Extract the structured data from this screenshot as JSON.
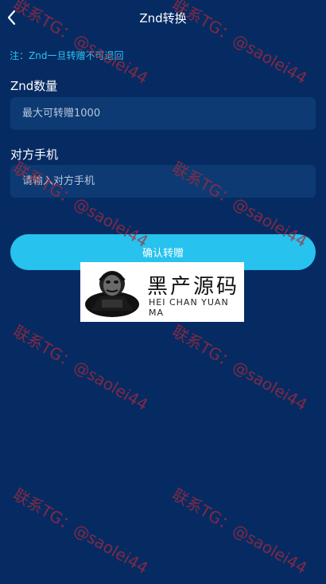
{
  "header": {
    "title": "Znd转换",
    "back_icon": "chevron-left-icon"
  },
  "notice": "注：Znd一旦转赠不可退回",
  "form": {
    "amount_label": "Znd数量",
    "amount_placeholder": "最大可转赠1000",
    "phone_label": "对方手机",
    "phone_placeholder": "请输入对方手机",
    "submit_label": "确认转赠"
  },
  "watermark": {
    "text": "联系TG：@saolei44",
    "color": "#a8293a"
  },
  "logo": {
    "text_cn": "黑产源码",
    "text_en": "HEI CHAN YUAN MA"
  },
  "colors": {
    "background": "#062b63",
    "accent": "#27c2ee",
    "field": "#0d3a73"
  }
}
